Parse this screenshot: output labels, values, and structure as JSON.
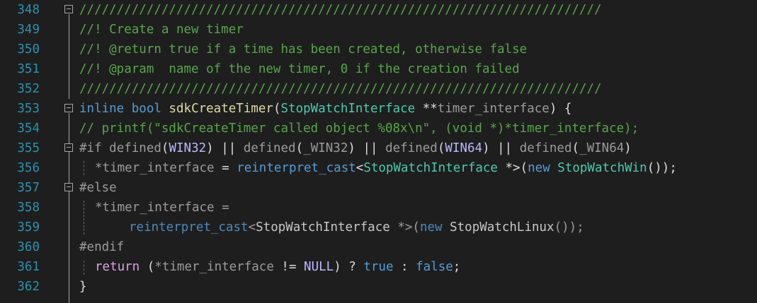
{
  "colors": {
    "background": "#1e1e1e",
    "line_number": "#2b91af",
    "comment": "#57a64a",
    "keyword": "#569cd6",
    "type": "#4ec9b0",
    "function": "#dcdcaa",
    "macro": "#beb7ff",
    "preprocessor": "#9b9b9b"
  },
  "lines": [
    {
      "num": "348",
      "code": "//////////////////////////////////////////////////////////////////////"
    },
    {
      "num": "349",
      "code": "//! Create a new timer"
    },
    {
      "num": "350",
      "code": "//! @return true if a time has been created, otherwise false"
    },
    {
      "num": "351",
      "code": "//! @param  name of the new timer, 0 if the creation failed"
    },
    {
      "num": "352",
      "code": "//////////////////////////////////////////////////////////////////////"
    },
    {
      "num": "353",
      "t": {
        "kw1": "inline",
        "kw2": "bool",
        "fn": "sdkCreateTimer",
        "p1": "(",
        "type": "StopWatchInterface",
        "p2": " **",
        "var": "timer_interface",
        "p3": ") {"
      }
    },
    {
      "num": "354",
      "code": "// printf(\"sdkCreateTimer called object %08x\\n\", (void *)*timer_interface);"
    },
    {
      "num": "355",
      "t": {
        "pp": "#if",
        "d1": "defined",
        "o1": "(",
        "m1": "WIN32",
        "o2": ") || ",
        "d2": "defined",
        "o3": "(",
        "m2": "_WIN32",
        "o4": ") || ",
        "d3": "defined",
        "o5": "(",
        "m3": "WIN64",
        "o6": ") || ",
        "d4": "defined",
        "o7": "(",
        "m4": "_WIN64",
        "o8": ")"
      }
    },
    {
      "num": "356",
      "t": {
        "v": "*timer_interface",
        "eq": " = ",
        "kw": "reinterpret_cast",
        "lt": "<",
        "type": "StopWatchInterface",
        "ptr": " *>(",
        "nw": "new",
        "sp": " ",
        "type2": "StopWatchWin",
        "end": "());"
      }
    },
    {
      "num": "357",
      "t": {
        "pp": "#else"
      }
    },
    {
      "num": "358",
      "t": {
        "v": "*timer_interface",
        "eq": " ="
      }
    },
    {
      "num": "359",
      "t": {
        "kw": "reinterpret_cast",
        "lt": "<",
        "type": "StopWatchInterface",
        "ptr": " *>(",
        "nw": "new",
        "sp": " ",
        "type2": "StopWatchLinux",
        "end": "());"
      }
    },
    {
      "num": "360",
      "t": {
        "pp": "#endif"
      }
    },
    {
      "num": "361",
      "t": {
        "ret": "return",
        "p1": " (",
        "v": "*timer_interface",
        "op": " != ",
        "m": "NULL",
        "p2": ") ? ",
        "tr": "true",
        "c": " : ",
        "fa": "false",
        "sc": ";"
      }
    },
    {
      "num": "362",
      "t": {
        "brace": "}"
      }
    }
  ]
}
